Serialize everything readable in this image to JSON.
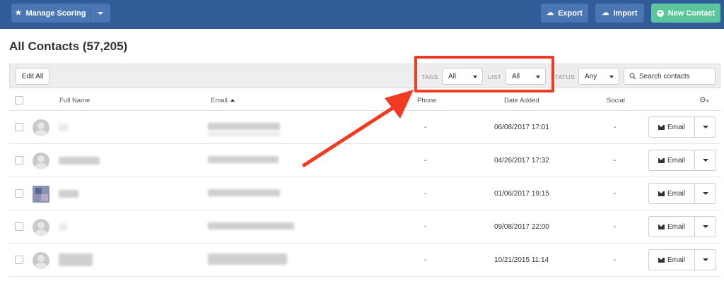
{
  "header": {
    "manage_scoring_label": "Manage Scoring",
    "export_label": "Export",
    "import_label": "Import",
    "new_contact_label": "New Contact"
  },
  "page": {
    "title": "All Contacts (57,205)"
  },
  "toolbar": {
    "edit_all_label": "Edit All",
    "tags_label": "TAGS",
    "tags_value": "All",
    "list_label": "LIST",
    "list_value": "All",
    "status_label": "STATUS",
    "status_value": "Any",
    "search_placeholder": "Search contacts"
  },
  "table": {
    "columns": {
      "full_name": "Full Name",
      "email": "Email",
      "phone": "Phone",
      "date_added": "Date Added",
      "social": "Social"
    },
    "rows": [
      {
        "phone": "-",
        "date_added": "06/08/2017 17:01",
        "social": "-",
        "action": "Email"
      },
      {
        "phone": "-",
        "date_added": "04/26/2017 17:32",
        "social": "-",
        "action": "Email"
      },
      {
        "phone": "-",
        "date_added": "01/06/2017 19:15",
        "social": "-",
        "action": "Email"
      },
      {
        "phone": "-",
        "date_added": "09/08/2017 22:00",
        "social": "-",
        "action": "Email"
      },
      {
        "phone": "-",
        "date_added": "10/21/2015 11:14",
        "social": "-",
        "action": "Email"
      }
    ]
  },
  "colors": {
    "topbar": "#315c97",
    "button_blue": "#4a76b3",
    "button_green": "#5bc59b",
    "annotation_red": "#f03a22"
  },
  "icons": [
    "star-icon",
    "upload-icon",
    "plus-icon",
    "search-icon",
    "gear-icon",
    "envelope-icon",
    "caret-down-icon",
    "sort-asc-icon"
  ]
}
